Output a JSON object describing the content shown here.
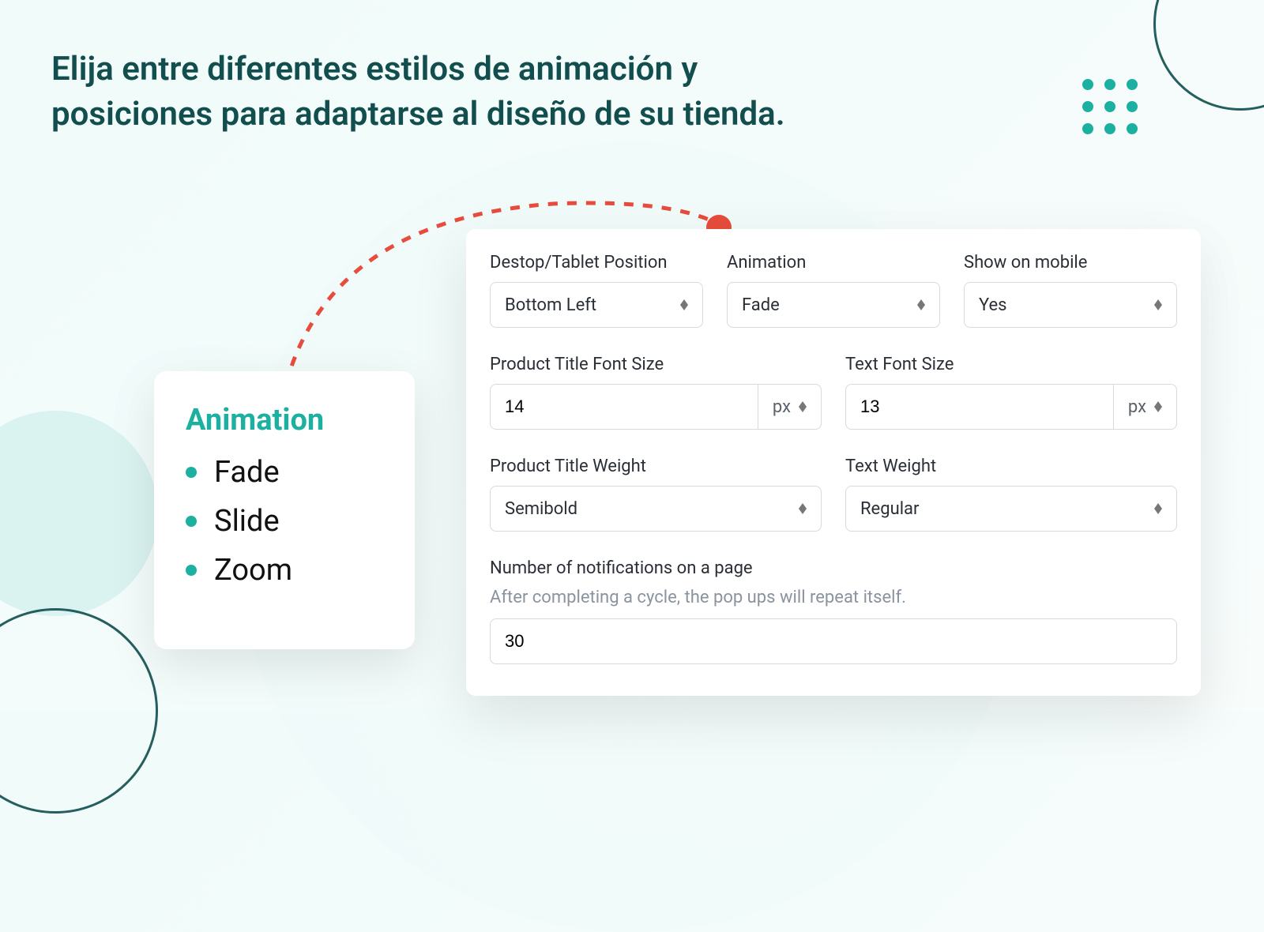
{
  "headline": "Elija entre diferentes estilos de animación y posiciones para adaptarse al diseño de su tienda.",
  "animation_card": {
    "title": "Animation",
    "options": [
      "Fade",
      "Slide",
      "Zoom"
    ]
  },
  "settings": {
    "position": {
      "label": "Destop/Tablet Position",
      "value": "Bottom Left"
    },
    "animation": {
      "label": "Animation",
      "value": "Fade"
    },
    "mobile": {
      "label": "Show on mobile",
      "value": "Yes"
    },
    "title_size": {
      "label": "Product Title Font Size",
      "value": "14",
      "unit": "px"
    },
    "text_size": {
      "label": "Text Font Size",
      "value": "13",
      "unit": "px"
    },
    "title_weight": {
      "label": "Product Title Weight",
      "value": "Semibold"
    },
    "text_weight": {
      "label": "Text Weight",
      "value": "Regular"
    },
    "notif_count": {
      "label": "Number of notifications on a page",
      "help": "After completing a cycle, the pop ups will repeat itself.",
      "value": "30"
    }
  }
}
